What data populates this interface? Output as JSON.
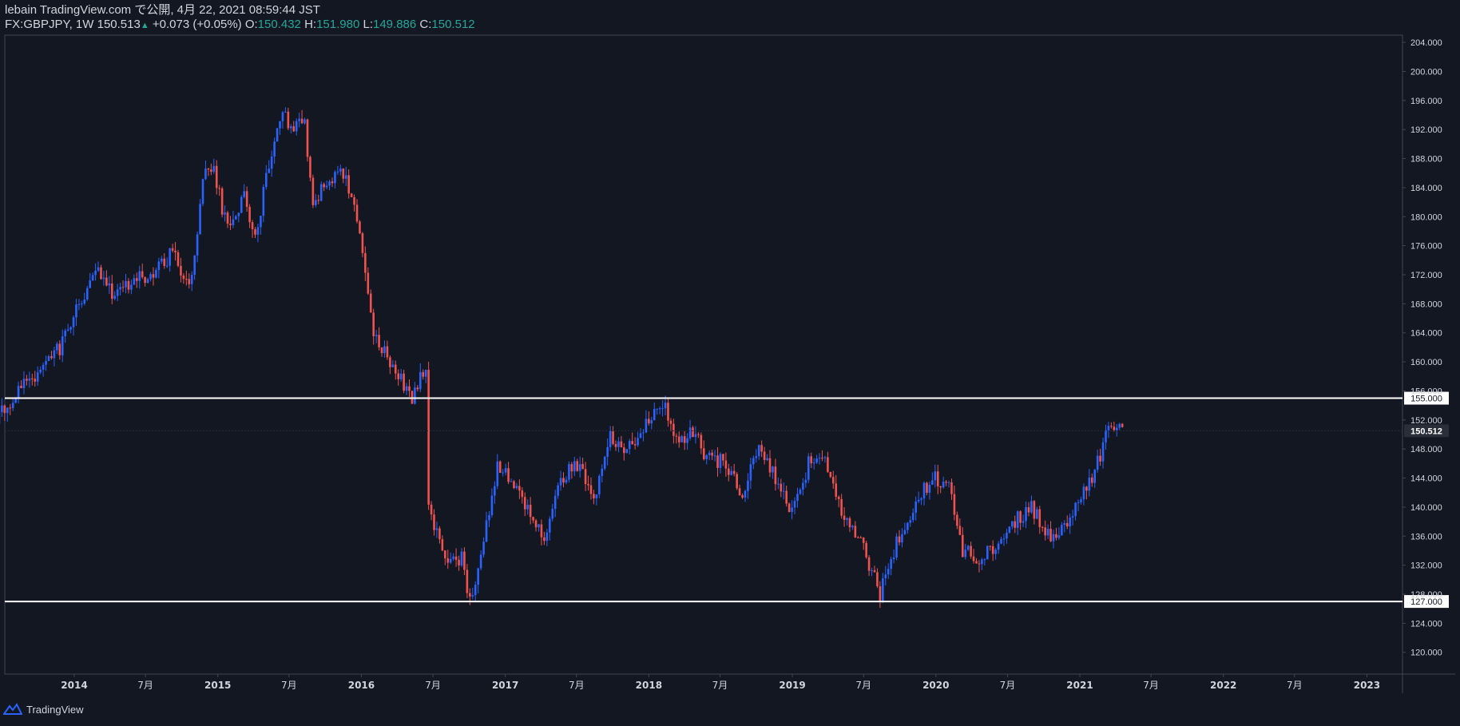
{
  "header": {
    "publish_line": "lebain TradingView.com で公開, 4月 22, 2021 08:59:44 JST",
    "symbol": "FX:GBPJPY, 1W",
    "last": "150.513",
    "change": "+0.073 (+0.05%)",
    "o_label": "O:",
    "o": "150.432",
    "h_label": "H:",
    "h": "151.980",
    "l_label": "L:",
    "l": "149.886",
    "c_label": "C:",
    "c": "150.512"
  },
  "footer": {
    "brand": "TradingView"
  },
  "colors": {
    "bg": "#131722",
    "up": "#2962ff",
    "down": "#ef5350",
    "hline": "#ffffff",
    "grid": "#2a2e39",
    "text": "#d1d4dc",
    "ohlc": "#26a69a"
  },
  "chart_data": {
    "type": "candlestick",
    "title": "",
    "xlabel": "",
    "ylabel": "",
    "ylim": [
      117,
      205
    ],
    "x_ticks": [
      "2014",
      "7月",
      "2015",
      "7月",
      "2016",
      "7月",
      "2017",
      "7月",
      "2018",
      "7月",
      "2019",
      "7月",
      "2020",
      "7月",
      "2021",
      "7月",
      "2022",
      "7月",
      "2023"
    ],
    "y_ticks": [
      "204.000",
      "200.000",
      "196.000",
      "192.000",
      "188.000",
      "184.000",
      "180.000",
      "176.000",
      "172.000",
      "168.000",
      "164.000",
      "160.000",
      "156.000",
      "152.000",
      "148.000",
      "144.000",
      "140.000",
      "136.000",
      "132.000",
      "128.000",
      "124.000",
      "120.000"
    ],
    "horizontal_lines": [
      {
        "value": 155,
        "label": "155.000"
      },
      {
        "value": 127,
        "label": "127.000"
      }
    ],
    "last_price": {
      "value": 150.512,
      "label": "150.512"
    },
    "series_path": [
      [
        "2013-04-08",
        151
      ],
      [
        "2013-05-20",
        150
      ],
      [
        "2013-07-01",
        153
      ],
      [
        "2013-08-19",
        156
      ],
      [
        "2013-10-07",
        158
      ],
      [
        "2013-12-02",
        162
      ],
      [
        "2014-01-20",
        168
      ],
      [
        "2014-03-03",
        173
      ],
      [
        "2014-04-21",
        169
      ],
      [
        "2014-06-02",
        171
      ],
      [
        "2014-07-21",
        172
      ],
      [
        "2014-09-15",
        175
      ],
      [
        "2014-10-27",
        170
      ],
      [
        "2014-12-08",
        187
      ],
      [
        "2014-12-29",
        186
      ],
      [
        "2015-02-02",
        178
      ],
      [
        "2015-03-16",
        183
      ],
      [
        "2015-04-13",
        177
      ],
      [
        "2015-05-25",
        189
      ],
      [
        "2015-06-22",
        194
      ],
      [
        "2015-07-20",
        192
      ],
      [
        "2015-08-17",
        193
      ],
      [
        "2015-09-07",
        182
      ],
      [
        "2015-10-12",
        185
      ],
      [
        "2015-11-23",
        186
      ],
      [
        "2015-12-28",
        180
      ],
      [
        "2016-02-08",
        164
      ],
      [
        "2016-03-21",
        160
      ],
      [
        "2016-05-16",
        155
      ],
      [
        "2016-06-20",
        160
      ],
      [
        "2016-06-27",
        140
      ],
      [
        "2016-08-15",
        132
      ],
      [
        "2016-09-19",
        133
      ],
      [
        "2016-10-10",
        127
      ],
      [
        "2016-11-14",
        135
      ],
      [
        "2016-12-19",
        146
      ],
      [
        "2017-01-30",
        143
      ],
      [
        "2017-03-06",
        140
      ],
      [
        "2017-04-17",
        136
      ],
      [
        "2017-05-29",
        144
      ],
      [
        "2017-07-10",
        146
      ],
      [
        "2017-08-21",
        141
      ],
      [
        "2017-10-02",
        150
      ],
      [
        "2017-11-13",
        148
      ],
      [
        "2017-12-25",
        151
      ],
      [
        "2018-02-19",
        154
      ],
      [
        "2018-03-26",
        148
      ],
      [
        "2018-04-23",
        151
      ],
      [
        "2018-06-04",
        147
      ],
      [
        "2018-07-23",
        146
      ],
      [
        "2018-09-03",
        142
      ],
      [
        "2018-10-15",
        148
      ],
      [
        "2018-11-26",
        144
      ],
      [
        "2019-01-07",
        139
      ],
      [
        "2019-02-18",
        146
      ],
      [
        "2019-04-01",
        146
      ],
      [
        "2019-05-13",
        139
      ],
      [
        "2019-06-24",
        136
      ],
      [
        "2019-08-19",
        128
      ],
      [
        "2019-09-30",
        135
      ],
      [
        "2019-11-18",
        141
      ],
      [
        "2020-01-06",
        144
      ],
      [
        "2020-02-17",
        142
      ],
      [
        "2020-03-16",
        134
      ],
      [
        "2020-04-27",
        133
      ],
      [
        "2020-06-15",
        135
      ],
      [
        "2020-07-27",
        138
      ],
      [
        "2020-09-07",
        140
      ],
      [
        "2020-10-19",
        136
      ],
      [
        "2020-12-07",
        138
      ],
      [
        "2021-01-18",
        142
      ],
      [
        "2021-02-22",
        146
      ],
      [
        "2021-03-22",
        151
      ],
      [
        "2021-04-12",
        152
      ],
      [
        "2021-04-19",
        150.5
      ]
    ]
  }
}
